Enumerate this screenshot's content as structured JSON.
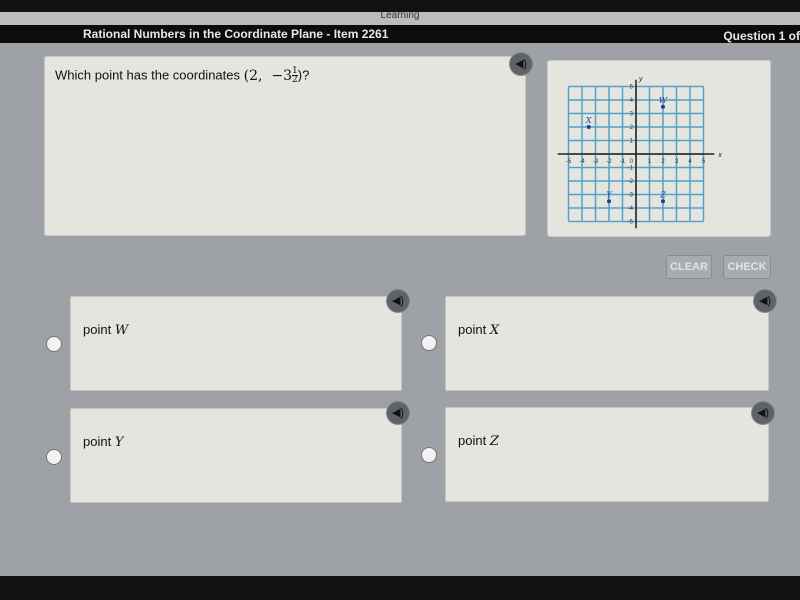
{
  "header": {
    "brand": "Learning",
    "title": "Rational Numbers in the Coordinate Plane - Item 2261",
    "question_counter": "Question 1 of"
  },
  "question": {
    "prefix": "Which point has the coordinates",
    "coord_x": "(2,",
    "coord_y_whole": "−3",
    "coord_y_num": "1",
    "coord_y_den": "2",
    "suffix": ")?"
  },
  "buttons": {
    "clear": "CLEAR",
    "check": "CHECK"
  },
  "options": [
    {
      "prefix": "point",
      "var": "W"
    },
    {
      "prefix": "point",
      "var": "X"
    },
    {
      "prefix": "point",
      "var": "Y"
    },
    {
      "prefix": "point",
      "var": "Z"
    }
  ],
  "graph": {
    "xlabel": "x",
    "ylabel": "y",
    "range": [
      -5,
      5
    ],
    "grid_color": "#4fa3c9",
    "points": [
      {
        "label": "W",
        "x": 2,
        "y": 3.5
      },
      {
        "label": "X",
        "x": -3.5,
        "y": 2
      },
      {
        "label": "Y",
        "x": -2,
        "y": -3.5
      },
      {
        "label": "Z",
        "x": 2,
        "y": -3.5
      }
    ]
  },
  "icons": {
    "speaker": "speaker-icon"
  }
}
